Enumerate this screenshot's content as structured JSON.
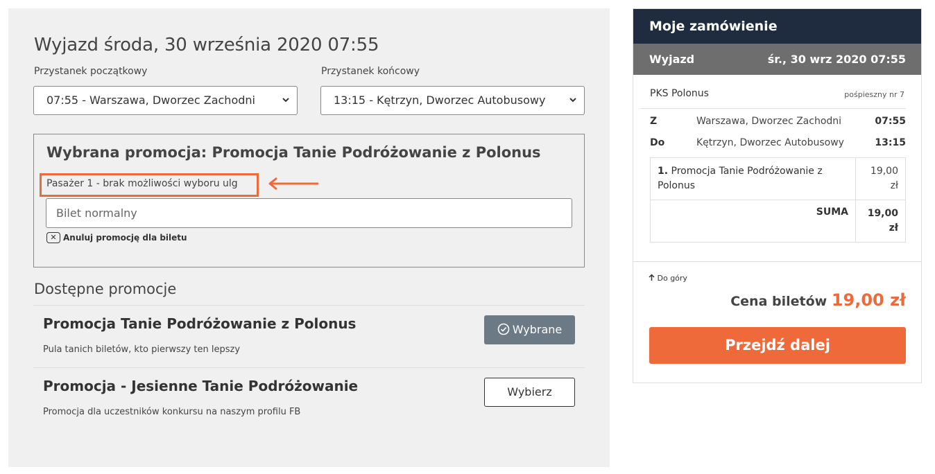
{
  "departure": {
    "title": "Wyjazd środa, 30 września 2020 07:55",
    "start_label": "Przystanek początkowy",
    "end_label": "Przystanek końcowy",
    "start_value": "07:55 - Warszawa, Dworzec Zachodni",
    "end_value": "13:15 - Kętrzyn, Dworzec Autobusowy"
  },
  "selected_promo": {
    "title": "Wybrana promocja: Promocja Tanie Podróżowanie z Polonus",
    "passenger_label": "Pasażer 1 - brak możliwości wyboru ulg",
    "ticket_value": "Bilet normalny",
    "cancel_label": "Anuluj promocję dla biletu"
  },
  "available": {
    "title": "Dostępne promocje",
    "items": [
      {
        "name": "Promocja Tanie Podróżowanie z Polonus",
        "desc": "Pula tanich biletów, kto pierwszy ten lepszy",
        "button": "Wybrane"
      },
      {
        "name": "Promocja - Jesienne Tanie Podróżowanie",
        "desc": "Promocja dla uczestników konkursu na naszym profilu FB",
        "button": "Wybierz"
      }
    ]
  },
  "order": {
    "header": "Moje zamówienie",
    "dep_label": "Wyjazd",
    "dep_date": "śr., 30 wrz 2020 07:55",
    "carrier": "PKS Polonus",
    "carrier_type": "pośpieszny nr 7",
    "from_key": "Z",
    "from_stop": "Warszawa, Dworzec Zachodni",
    "from_time": "07:55",
    "to_key": "Do",
    "to_stop": "Kętrzyn, Dworzec Autobusowy",
    "to_time": "13:15",
    "item_num": "1.",
    "item_name": "Promocja Tanie Podróżowanie z Polonus",
    "item_price": "19,00 zł",
    "sum_label": "SUMA",
    "sum_value": "19,00 zł",
    "to_top": "Do góry",
    "total_label": "Cena biletów",
    "total_value": "19,00 zł",
    "next_button": "Przejdź dalej"
  },
  "colors": {
    "accent": "#ef6a3a",
    "header_bg": "#1f2b3e",
    "selected_btn": "#6b7a85"
  }
}
